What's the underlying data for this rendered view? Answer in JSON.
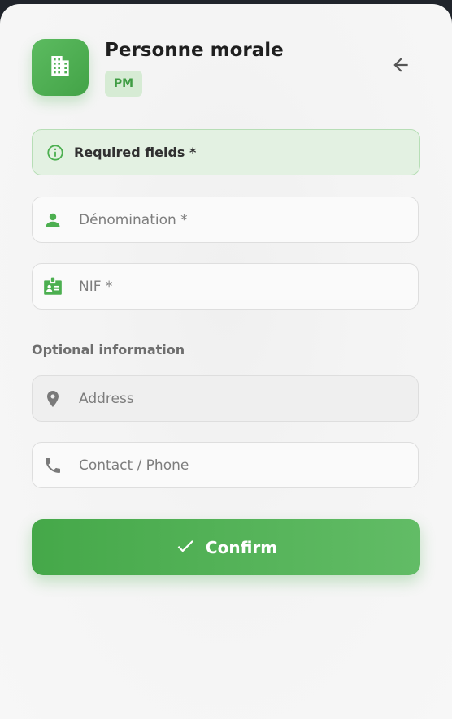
{
  "header": {
    "title": "Personne morale",
    "badge": "PM",
    "icon": "building-icon",
    "back_icon": "arrow-left-icon"
  },
  "notice": {
    "icon": "info-circle-icon",
    "text": "Required fields *"
  },
  "fields": {
    "denomination": {
      "placeholder": "Dénomination *",
      "icon": "person-icon"
    },
    "nif": {
      "placeholder": "NIF *",
      "icon": "id-badge-icon"
    },
    "address": {
      "placeholder": "Address",
      "icon": "location-pin-icon"
    },
    "contact": {
      "placeholder": "Contact / Phone",
      "icon": "phone-icon"
    }
  },
  "optional_section": {
    "label": "Optional information"
  },
  "confirm": {
    "label": "Confirm",
    "icon": "check-icon"
  },
  "colors": {
    "accent": "#4caf50",
    "badge_bg": "#d6ebd4",
    "notice_bg": "#e3f1e2",
    "muted_icon": "#7a7a7a"
  }
}
